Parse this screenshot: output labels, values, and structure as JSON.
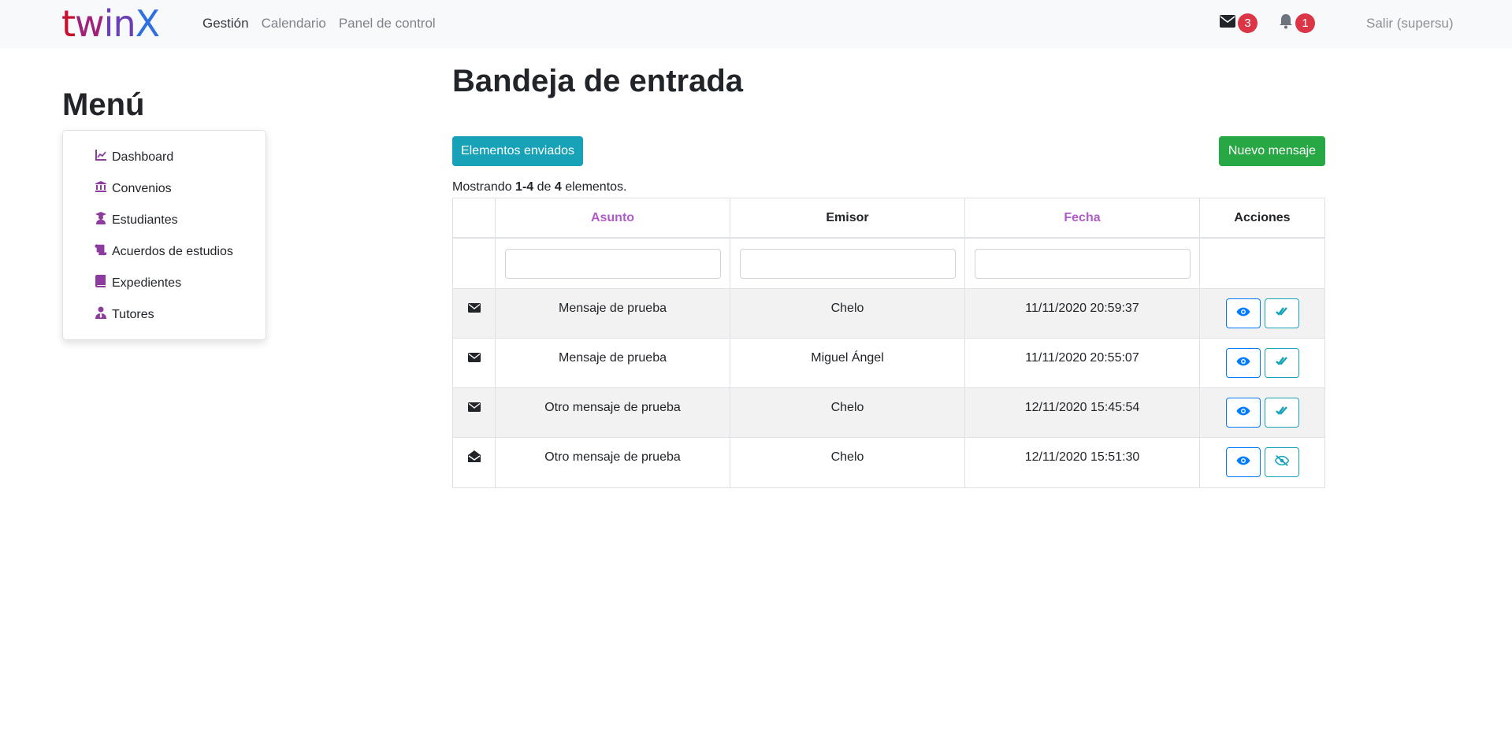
{
  "navbar": {
    "brand": [
      "t",
      "w",
      "in",
      "X"
    ],
    "links": [
      "Gestión",
      "Calendario",
      "Panel de control"
    ],
    "messages_count": "3",
    "notifications_count": "1",
    "logout": "Salir (supersu)"
  },
  "sidebar": {
    "title": "Menú",
    "items": [
      {
        "label": "Dashboard",
        "icon": "chart-line-icon"
      },
      {
        "label": "Convenios",
        "icon": "university-icon"
      },
      {
        "label": "Estudiantes",
        "icon": "user-graduate-icon"
      },
      {
        "label": "Acuerdos de estudios",
        "icon": "scroll-icon"
      },
      {
        "label": "Expedientes",
        "icon": "book-icon"
      },
      {
        "label": "Tutores",
        "icon": "user-tie-icon"
      }
    ]
  },
  "main": {
    "title": "Bandeja de entrada",
    "sent_button": "Elementos enviados",
    "new_button": "Nuevo mensaje",
    "summary": {
      "prefix": "Mostrando ",
      "range": "1-4",
      "middle": " de ",
      "total": "4",
      "suffix": " elementos."
    },
    "columns": [
      "Asunto",
      "Emisor",
      "Fecha",
      "Acciones"
    ],
    "rows": [
      {
        "asunto": "Mensaje de prueba",
        "emisor": "Chelo",
        "fecha": "11/11/2020 20:59:37",
        "read": false
      },
      {
        "asunto": "Mensaje de prueba",
        "emisor": "Miguel Ángel",
        "fecha": "11/11/2020 20:55:07",
        "read": false
      },
      {
        "asunto": "Otro mensaje de prueba",
        "emisor": "Chelo",
        "fecha": "12/11/2020 15:45:54",
        "read": false
      },
      {
        "asunto": "Otro mensaje de prueba",
        "emisor": "Chelo",
        "fecha": "12/11/2020 15:51:30",
        "read": true
      }
    ]
  },
  "colors": {
    "accent_purple": "#8e3ba0",
    "info": "#17a2b8",
    "success": "#28a745",
    "danger": "#dc3545",
    "primary": "#007bff"
  }
}
